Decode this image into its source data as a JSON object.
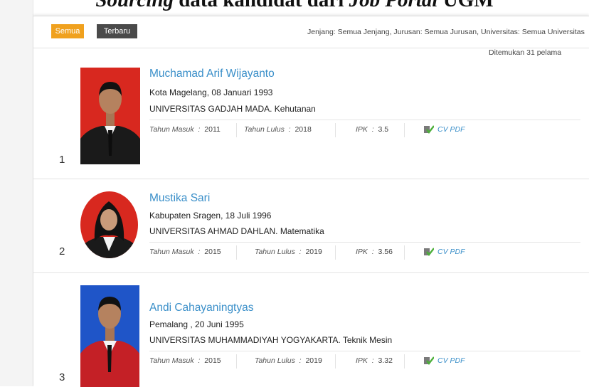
{
  "caption": {
    "part1": "Sourcing",
    "part2": " data kandidat dari ",
    "part3": "Job Portal",
    "part4": " UGM"
  },
  "filters": {
    "semua_label": "Semua",
    "terbaru_label": "Terbaru",
    "summary": "Jenjang: Semua Jenjang, Jurusan: Semua Jurusan, Universitas: Semua Universitas,..."
  },
  "results_count_text": "Ditemukan 31 pelama",
  "meta_labels": {
    "tahun_masuk": "Tahun Masuk",
    "tahun_lulus": "Tahun Lulus",
    "ipk": "IPK",
    "colon": ":",
    "cv": "CV PDF"
  },
  "candidates": [
    {
      "number": "1",
      "name": "Muchamad Arif Wijayanto",
      "birth": "Kota Magelang, 08 Januari 1993",
      "education": "UNIVERSITAS GADJAH MADA. Kehutanan",
      "tahun_masuk": "2011",
      "tahun_lulus": "2018",
      "ipk": "3.5",
      "photo_bg": "#d8281f"
    },
    {
      "number": "2",
      "name": "Mustika Sari",
      "birth": "Kabupaten Sragen, 18 Juli 1996",
      "education": "UNIVERSITAS AHMAD DAHLAN. Matematika",
      "tahun_masuk": "2015",
      "tahun_lulus": "2019",
      "ipk": "3.56",
      "photo_bg": "#d8281f"
    },
    {
      "number": "3",
      "name": "Andi Cahayaningtyas",
      "birth": "Pemalang , 20 Juni 1995",
      "education": "UNIVERSITAS MUHAMMADIYAH YOGYAKARTA. Teknik Mesin",
      "tahun_masuk": "2015",
      "tahun_lulus": "2019",
      "ipk": "3.32",
      "photo_bg": "#1f55c8"
    }
  ],
  "colors": {
    "accent_orange": "#f0a11e",
    "link_blue": "#3a8fc9",
    "dark_button": "#4a4a4a",
    "cv_icon_green": "#4caf3a"
  }
}
